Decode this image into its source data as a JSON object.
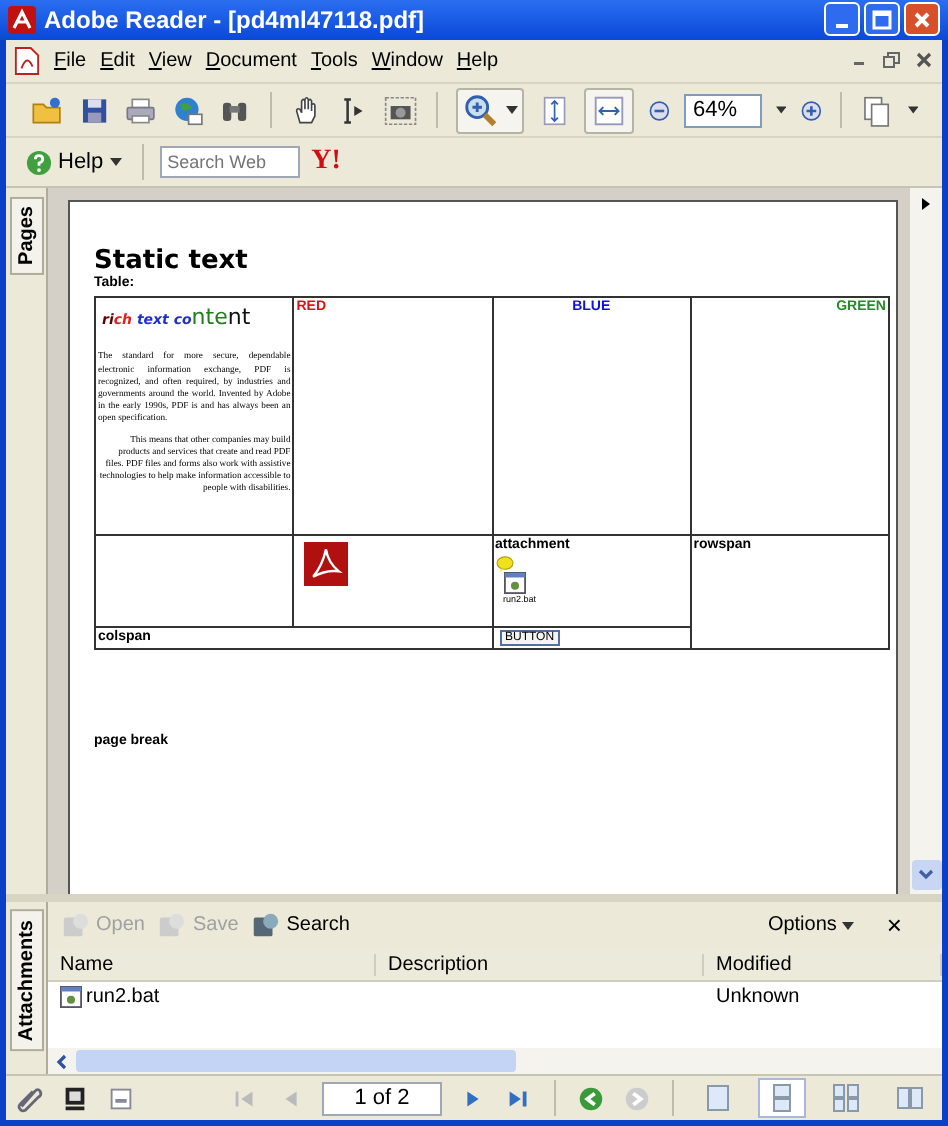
{
  "window": {
    "title": "Adobe Reader - [pd4ml47118.pdf]"
  },
  "menu": [
    "File",
    "Edit",
    "View",
    "Document",
    "Tools",
    "Window",
    "Help"
  ],
  "toolbar": {
    "zoom": "64%",
    "help": "Help",
    "search_placeholder": "Search Web",
    "yahoo": "Y!"
  },
  "side_tabs": {
    "pages": "Pages",
    "attachments": "Attachments"
  },
  "document": {
    "title": "Static text",
    "subtitle": "Table:",
    "rich_text": [
      {
        "text": "ri",
        "color": "#600000",
        "large": false
      },
      {
        "text": "ch ",
        "color": "#e02020",
        "large": false
      },
      {
        "text": "text co",
        "color": "#2030d0",
        "large": false
      },
      {
        "text": "nte",
        "color": "#208020",
        "large": true
      },
      {
        "text": "nt",
        "color": "#111111",
        "large": true
      }
    ],
    "paragraphs": [
      "The standard for more secure, dependable electronic information exchange, PDF is recognized, and often required, by industries and governments around the world. Invented by Adobe in the early 1990s, PDF is and has always been an open specification.",
      "This means that other companies may build products and services that create and read PDF files. PDF files and forms also work with assistive technologies to help make information accessible to people with disabilities."
    ],
    "color_headers": [
      {
        "text": "RED",
        "color": "#e01010"
      },
      {
        "text": "BLUE",
        "color": "#1010e0"
      },
      {
        "text": "GREEN",
        "color": "#209020"
      }
    ],
    "attachment_label": "attachment",
    "attachment_file": "run2.bat",
    "rowspan_label": "rowspan",
    "colspan_label": "colspan",
    "button": "BUTTON",
    "page_break": "page break"
  },
  "attachments": {
    "tools": [
      {
        "label": "Open",
        "disabled": true
      },
      {
        "label": "Save",
        "disabled": true
      },
      {
        "label": "Search",
        "disabled": false
      }
    ],
    "options": "Options",
    "close": "×",
    "columns": [
      "Name",
      "Description",
      "Modified"
    ],
    "rows": [
      {
        "name": "run2.bat",
        "description": "",
        "modified": "Unknown"
      }
    ]
  },
  "status_bar": {
    "page": "1 of 2",
    "view_modes": [
      {
        "selected": false
      },
      {
        "selected": true
      },
      {
        "selected": false
      },
      {
        "selected": false
      }
    ]
  }
}
